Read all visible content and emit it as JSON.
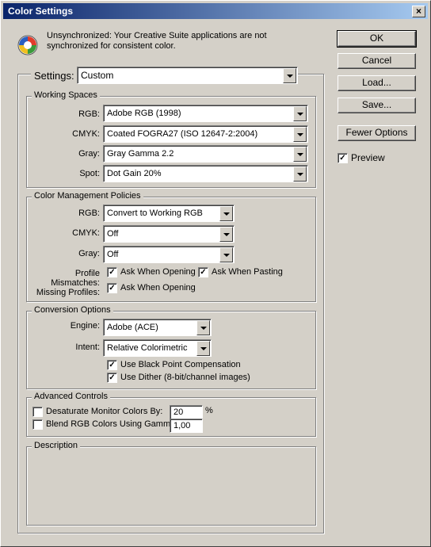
{
  "window": {
    "title": "Color Settings",
    "close": "×"
  },
  "sync_message": "Unsynchronized: Your Creative Suite applications are not synchronized for consistent color.",
  "settings": {
    "label": "Settings:",
    "value": "Custom"
  },
  "buttons": {
    "ok": "OK",
    "cancel": "Cancel",
    "load": "Load...",
    "save": "Save...",
    "fewer": "Fewer Options"
  },
  "preview": {
    "label": "Preview",
    "checked": true
  },
  "working_spaces": {
    "title": "Working Spaces",
    "rgb": {
      "label": "RGB:",
      "value": "Adobe RGB (1998)"
    },
    "cmyk": {
      "label": "CMYK:",
      "value": "Coated FOGRA27 (ISO 12647-2:2004)"
    },
    "gray": {
      "label": "Gray:",
      "value": "Gray Gamma 2.2"
    },
    "spot": {
      "label": "Spot:",
      "value": "Dot Gain 20%"
    }
  },
  "policies": {
    "title": "Color Management Policies",
    "rgb": {
      "label": "RGB:",
      "value": "Convert to Working RGB"
    },
    "cmyk": {
      "label": "CMYK:",
      "value": "Off"
    },
    "gray": {
      "label": "Gray:",
      "value": "Off"
    },
    "mismatch_label": "Profile Mismatches:",
    "ask_opening": "Ask When Opening",
    "ask_pasting": "Ask When Pasting",
    "missing_label": "Missing Profiles:",
    "missing_ask_opening": "Ask When Opening"
  },
  "conversion": {
    "title": "Conversion Options",
    "engine": {
      "label": "Engine:",
      "value": "Adobe (ACE)"
    },
    "intent": {
      "label": "Intent:",
      "value": "Relative Colorimetric"
    },
    "black_point": "Use Black Point Compensation",
    "dither": "Use Dither (8-bit/channel images)"
  },
  "advanced": {
    "title": "Advanced Controls",
    "desaturate": {
      "label": "Desaturate Monitor Colors By:",
      "value": "20",
      "unit": "%"
    },
    "blend": {
      "label": "Blend RGB Colors Using Gamma:",
      "value": "1,00"
    }
  },
  "description": {
    "title": "Description"
  }
}
